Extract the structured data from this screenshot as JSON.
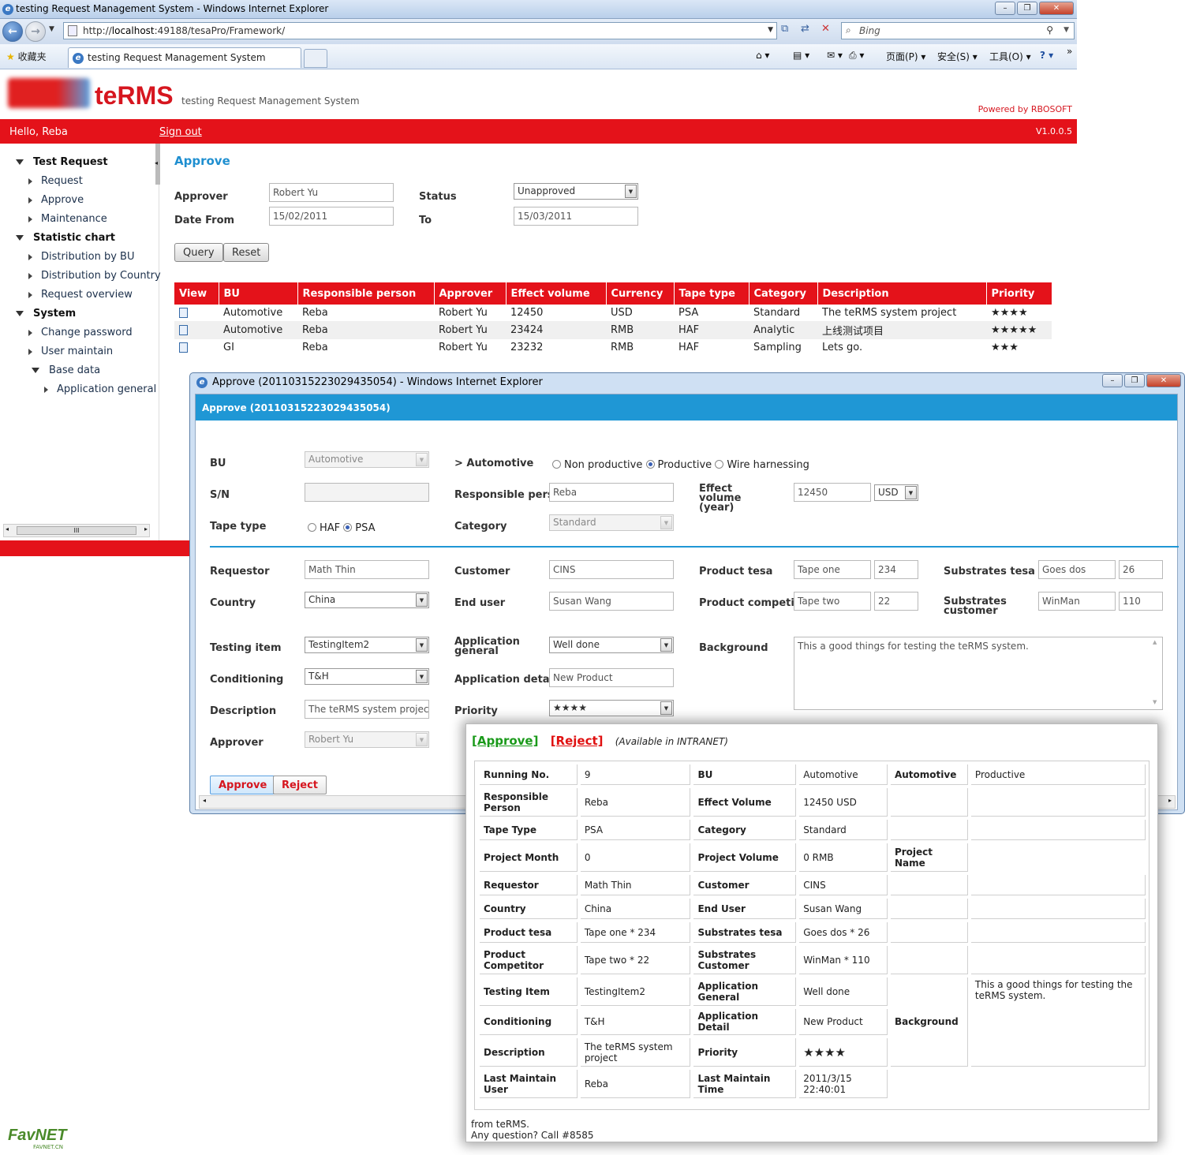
{
  "browser": {
    "title": "testing Request Management System - Windows Internet Explorer",
    "url_prefix": "http://",
    "url_host": "localhost",
    "url_rest": ":49188/tesaPro/Framework/",
    "search_placeholder": "Bing",
    "favorites": "收藏夹",
    "tab_title": "testing Request Management System",
    "menu_page": "页面(P)",
    "menu_safety": "安全(S)",
    "menu_tools": "工具(O)",
    "help": "?"
  },
  "app": {
    "brand": "teRMS",
    "subtitle": "testing Request Management System",
    "powered": "Powered by RBOSOFT",
    "hello": "Hello, Reba",
    "sign_out": "Sign out",
    "version": "V1.0.0.5"
  },
  "sidebar": {
    "test_request": "Test Request",
    "request": "Request",
    "approve": "Approve",
    "maintenance": "Maintenance",
    "statistic_chart": "Statistic chart",
    "dist_bu": "Distribution by BU",
    "dist_country": "Distribution by Country",
    "request_overview": "Request overview",
    "system": "System",
    "change_password": "Change password",
    "user_maintain": "User maintain",
    "base_data": "Base data",
    "application_general": "Application general",
    "scroll_grip": "III"
  },
  "filter": {
    "title": "Approve",
    "approver_label": "Approver",
    "approver_value": "Robert Yu",
    "status_label": "Status",
    "status_value": "Unapproved",
    "date_from_label": "Date From",
    "date_from_value": "15/02/2011",
    "to_label": "To",
    "to_value": "15/03/2011",
    "query": "Query",
    "reset": "Reset"
  },
  "grid": {
    "headers": [
      "View",
      "BU",
      "Responsible person",
      "Approver",
      "Effect volume",
      "Currency",
      "Tape type",
      "Category",
      "Description",
      "Priority"
    ],
    "rows": [
      [
        "Automotive",
        "Reba",
        "Robert Yu",
        "12450",
        "USD",
        "PSA",
        "Standard",
        "The teRMS system project",
        "★★★★"
      ],
      [
        "Automotive",
        "Reba",
        "Robert Yu",
        "23424",
        "RMB",
        "HAF",
        "Analytic",
        "上线测试项目",
        "★★★★★"
      ],
      [
        "GI",
        "Reba",
        "Robert Yu",
        "23232",
        "RMB",
        "HAF",
        "Sampling",
        "Lets go.",
        "★★★"
      ]
    ]
  },
  "popup": {
    "window_title": "Approve (20110315223029435054) - Windows Internet Explorer",
    "header": "Approve (20110315223029435054)",
    "bu_label": "BU",
    "bu_value": "Automotive",
    "bu_sub": "> Automotive",
    "radio_non": "Non productive",
    "radio_prod": "Productive",
    "radio_wire": "Wire harnessing",
    "sn_label": "S/N",
    "resp_label": "Responsible person",
    "resp_value": "Reba",
    "effect_label": "Effect volume (year)",
    "effect_value": "12450",
    "currency": "USD",
    "tape_label": "Tape type",
    "tape_haf": "HAF",
    "tape_psa": "PSA",
    "category_label": "Category",
    "category_value": "Standard",
    "requestor_label": "Requestor",
    "requestor_value": "Math Thin",
    "customer_label": "Customer",
    "customer_value": "CINS",
    "product_tesa_label": "Product tesa",
    "product_tesa_value": "Tape one",
    "product_tesa_num": "234",
    "substrates_tesa_label": "Substrates tesa",
    "substrates_tesa_value": "Goes dos",
    "substrates_tesa_num": "26",
    "country_label": "Country",
    "country_value": "China",
    "end_user_label": "End user",
    "end_user_value": "Susan Wang",
    "product_comp_label": "Product competitor",
    "product_comp_value": "Tape two",
    "product_comp_num": "22",
    "substrates_cust_label": "Substrates customer",
    "substrates_cust_value": "WinMan",
    "substrates_cust_num": "110",
    "testing_label": "Testing item",
    "testing_value": "TestingItem2",
    "app_general_label": "Application general",
    "app_general_value": "Well done",
    "background_label": "Background",
    "background_value": "This a good things for testing the teRMS system.",
    "conditioning_label": "Conditioning",
    "conditioning_value": "T&H",
    "app_detail_label": "Application detail",
    "app_detail_value": "New Product",
    "description_label": "Description",
    "description_value": "The teRMS system project",
    "priority_label": "Priority",
    "priority_value": "★★★★",
    "approver_label": "Approver",
    "approver_value": "Robert Yu",
    "approve_btn": "Approve",
    "reject_btn": "Reject"
  },
  "email": {
    "approve_link": "[Approve]",
    "reject_link": "[Reject]",
    "note": "(Available in INTRANET)",
    "rows": [
      [
        "Running No.",
        "9",
        "BU",
        "Automotive",
        "Automotive",
        "Productive"
      ],
      [
        "Responsible Person",
        "Reba",
        "Effect Volume",
        "12450 USD",
        "",
        ""
      ],
      [
        "Tape Type",
        "PSA",
        "Category",
        "Standard",
        "",
        ""
      ],
      [
        "Project Month",
        "0",
        "Project Volume",
        "0 RMB",
        "Project Name",
        ""
      ],
      [
        "Requestor",
        "Math Thin",
        "Customer",
        "CINS",
        "",
        ""
      ],
      [
        "Country",
        "China",
        "End User",
        "Susan Wang",
        "",
        ""
      ],
      [
        "Product tesa",
        "Tape one * 234",
        "Substrates tesa",
        "Goes dos * 26",
        "",
        ""
      ],
      [
        "Product Competitor",
        "Tape two * 22",
        "Substrates Customer",
        "WinMan * 110",
        "",
        ""
      ],
      [
        "Testing Item",
        "TestingItem2",
        "Application General",
        "Well done",
        "Background",
        "This a good things for testing the teRMS system."
      ],
      [
        "Conditioning",
        "T&H",
        "Application Detail",
        "New Product"
      ],
      [
        "Description",
        "The teRMS system project",
        "Priority",
        "★★★★"
      ],
      [
        "Last Maintain User",
        "Reba",
        "Last Maintain Time",
        "2011/3/15 22:40:01"
      ]
    ],
    "footer1": "from teRMS.",
    "footer2": "Any question? Call #8585"
  },
  "watermark": "FavNET",
  "watermark_sub": "FAVNET.CN"
}
